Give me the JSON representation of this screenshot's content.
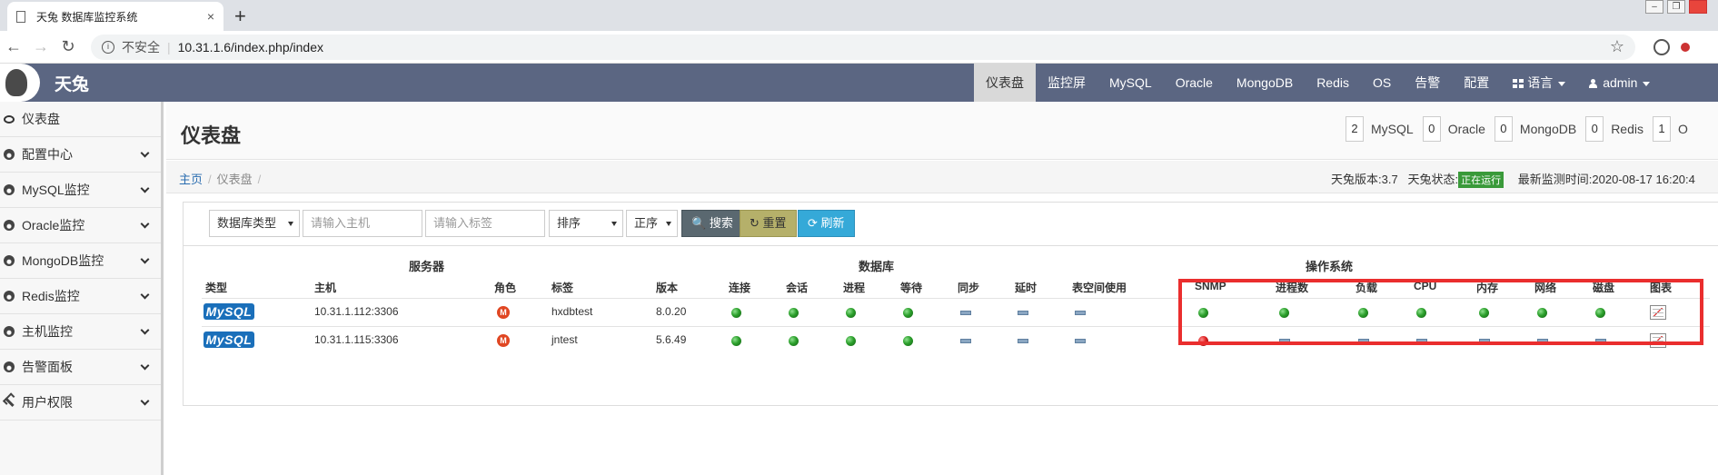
{
  "browser": {
    "tab_title": "天兔 数据库监控系统",
    "tab_close": "×",
    "new_tab": "+",
    "insecure_label": "不安全",
    "url": "10.31.1.6/index.php/index"
  },
  "header": {
    "brand": "天兔",
    "menu": [
      "仪表盘",
      "监控屏",
      "MySQL",
      "Oracle",
      "MongoDB",
      "Redis",
      "OS",
      "告警",
      "配置"
    ],
    "language": "语言",
    "user": "admin"
  },
  "sidebar": {
    "items": [
      {
        "label": "仪表盘",
        "icon": "chat-icon"
      },
      {
        "label": "配置中心",
        "icon": "gauge-icon"
      },
      {
        "label": "MySQL监控",
        "icon": "gauge-icon"
      },
      {
        "label": "Oracle监控",
        "icon": "gauge-icon"
      },
      {
        "label": "MongoDB监控",
        "icon": "gauge-icon"
      },
      {
        "label": "Redis监控",
        "icon": "gauge-icon"
      },
      {
        "label": "主机监控",
        "icon": "gauge-icon"
      },
      {
        "label": "告警面板",
        "icon": "gauge-icon"
      },
      {
        "label": "用户权限",
        "icon": "wrench-icon"
      }
    ]
  },
  "page": {
    "title": "仪表盘",
    "counters": [
      {
        "count": "2",
        "label": "MySQL"
      },
      {
        "count": "0",
        "label": "Oracle"
      },
      {
        "count": "0",
        "label": "MongoDB"
      },
      {
        "count": "0",
        "label": "Redis"
      },
      {
        "count": "1",
        "label": "O"
      }
    ],
    "breadcrumb": [
      "主页",
      "仪表盘"
    ],
    "version_label": "天兔版本:3.7",
    "status_label": "天兔状态:",
    "status_badge": "正在运行",
    "last_check": "最新监测时间:2020-08-17 16:20:4"
  },
  "filters": {
    "db_type": "数据库类型",
    "host_placeholder": "请输入主机",
    "tag_placeholder": "请输入标签",
    "sort": "排序",
    "order": "正序",
    "search": "搜索",
    "reset": "重置",
    "refresh": "刷新"
  },
  "table": {
    "groups": {
      "server": "服务器",
      "database": "数据库",
      "os": "操作系统"
    },
    "columns": [
      "类型",
      "主机",
      "角色",
      "标签",
      "版本",
      "连接",
      "会话",
      "进程",
      "等待",
      "同步",
      "延时",
      "表空间使用",
      "SNMP",
      "进程数",
      "负载",
      "CPU",
      "内存",
      "网络",
      "磁盘",
      "图表"
    ],
    "rows": [
      {
        "type": "MySQL",
        "host": "10.31.1.112:3306",
        "role": "M",
        "tag": "hxdbtest",
        "version": "8.0.20",
        "db": [
          "ok",
          "ok",
          "ok",
          "ok",
          "na",
          "na",
          "na"
        ],
        "os": [
          "ok",
          "ok",
          "ok",
          "ok",
          "ok",
          "ok",
          "ok"
        ]
      },
      {
        "type": "MySQL",
        "host": "10.31.1.115:3306",
        "role": "M",
        "tag": "jntest",
        "version": "5.6.49",
        "db": [
          "ok",
          "ok",
          "ok",
          "ok",
          "na",
          "na",
          "na"
        ],
        "os": [
          "error",
          "na",
          "na",
          "na",
          "na",
          "na",
          "na"
        ]
      }
    ]
  },
  "colors": {
    "nav_bg": "#5b6682",
    "highlight": "#ea2e2e",
    "status_ok": "#2ca02c",
    "status_error": "#d22222"
  }
}
